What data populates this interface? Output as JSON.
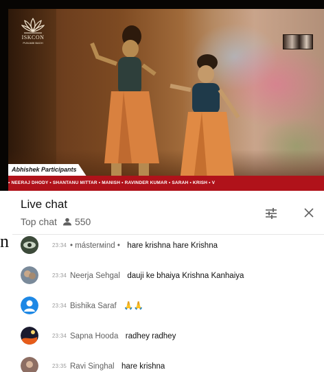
{
  "video": {
    "logo_text": "ISKCON",
    "logo_subtext": "PUNJABI BAGH",
    "participants_label": "Abhishek Participants",
    "participants_ticker": "• NEERAJ DHODY • SHANTANU MITTAR • MANISH • RAVINDER KUMAR • SARAH • KRISH • V"
  },
  "chat": {
    "title": "Live chat",
    "mode_label": "Top chat",
    "viewer_count": "550",
    "edge_glyph": "n",
    "messages": [
      {
        "time": "23:34",
        "author": "• másterмind •",
        "text": "hare krishna hare Krishna",
        "avatar_color": "#3c4a3a"
      },
      {
        "time": "23:34",
        "author": "Neerja Sehgal",
        "text": "dauji ke bhaiya Krishna Kanhaiya",
        "avatar_color": "#7a8a9a"
      },
      {
        "time": "23:34",
        "author": "Bishika Saraf",
        "text": "🙏🙏",
        "avatar_color": "#1e88e5"
      },
      {
        "time": "23:34",
        "author": "Sapna Hooda",
        "text": "radhey radhey",
        "avatar_color": "#1a1a2e"
      },
      {
        "time": "23:35",
        "author": "Ravi Singhal",
        "text": "hare krishna",
        "avatar_color": "#8d6e63"
      }
    ]
  },
  "colors": {
    "ticker_bg": "#b0121a",
    "header_text": "#0f0f0f",
    "secondary_text": "#606060"
  }
}
